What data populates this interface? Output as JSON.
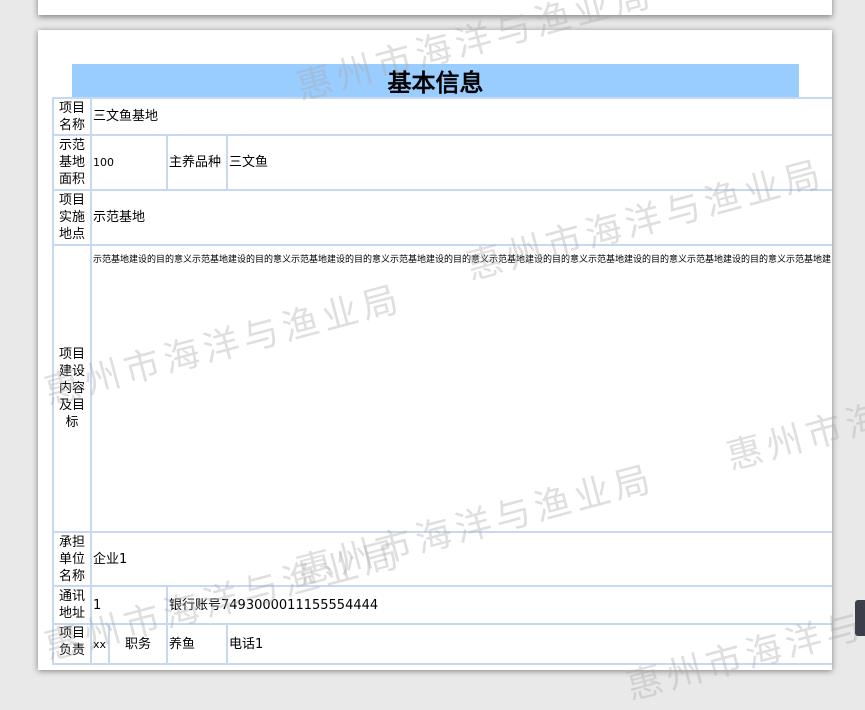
{
  "title": "基本信息",
  "watermark_text": "惠州市海洋与渔业局",
  "rows": {
    "project_name": {
      "label": "项目名称",
      "value": "三文鱼基地"
    },
    "demo_area": {
      "label": "示范基地面积",
      "value": "100",
      "species_label": "主养品种",
      "species_value": "三文鱼"
    },
    "location": {
      "label": "项目实施地点",
      "value": "示范基地"
    },
    "content": {
      "label": "项目建设内容及目标",
      "value": "示范基地建设的目的意义示范基地建设的目的意义示范基地建设的目的意义示范基地建设的目的意义示范基地建设的目的意义示范基地建设的目的意义示范基地建设的目的意义示范基地建设的目的意义"
    },
    "undertaker": {
      "label": "承担单位名称",
      "value": "企业1"
    },
    "address": {
      "label": "通讯地址",
      "value": "1",
      "bank_label": "银行账号",
      "bank_value": "7493000011155554444"
    },
    "leader": {
      "label": "项目负责",
      "name_value": "xx",
      "position_label": "职务",
      "position_value": "养鱼",
      "phone_label": "电话",
      "phone_value": "1"
    }
  }
}
